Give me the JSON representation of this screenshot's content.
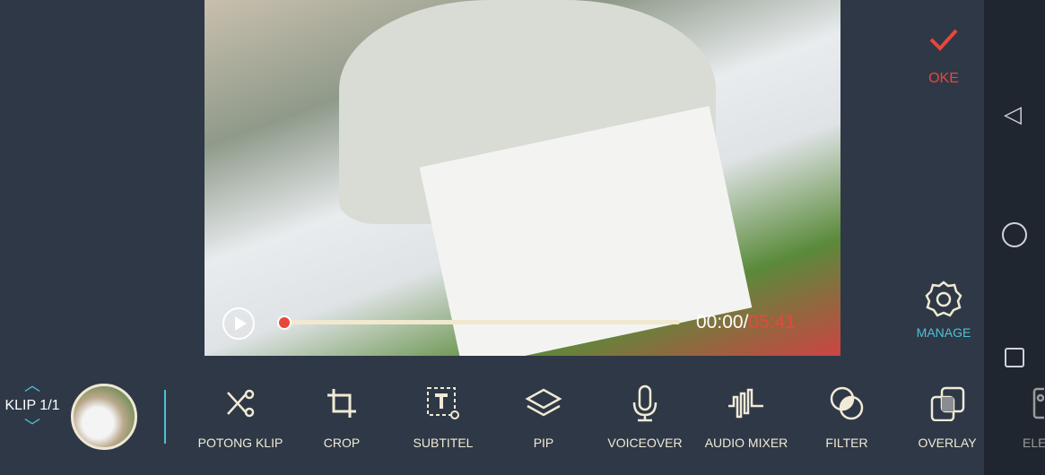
{
  "player": {
    "current_time": "00:00",
    "separator": "/",
    "total_time": "05:41",
    "progress": 0
  },
  "side": {
    "ok_label": "OKE",
    "manage_label": "MANAGE"
  },
  "clip": {
    "label": "KLIP 1/1"
  },
  "tools": [
    {
      "label": "POTONG KLIP",
      "icon": "scissors-icon"
    },
    {
      "label": "CROP",
      "icon": "crop-icon"
    },
    {
      "label": "SUBTITEL",
      "icon": "subtitle-icon"
    },
    {
      "label": "PIP",
      "icon": "layers-icon"
    },
    {
      "label": "VOICEOVER",
      "icon": "microphone-icon"
    },
    {
      "label": "AUDIO MIXER",
      "icon": "waveform-icon"
    },
    {
      "label": "FILTER",
      "icon": "filter-icon"
    },
    {
      "label": "OVERLAY",
      "icon": "overlay-icon"
    },
    {
      "label": "ELE",
      "icon": "image-icon"
    }
  ],
  "colors": {
    "accent": "#4ec3d6",
    "danger": "#e8473c",
    "background": "#2f3846"
  }
}
